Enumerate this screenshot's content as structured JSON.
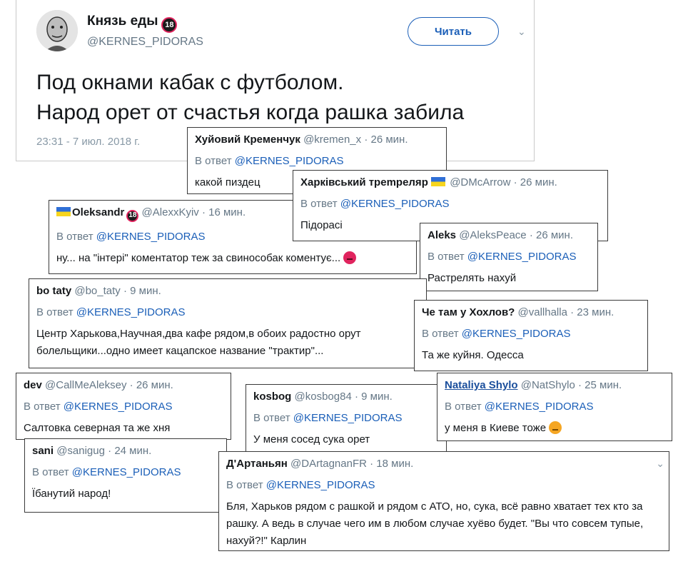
{
  "main": {
    "name": "Князь еды",
    "badge": "18",
    "handle": "@KERNES_PIDORAS",
    "follow_label": "Читать",
    "chevron": "chevron-down-icon",
    "text_line1": "Под окнами кабак с футболом.",
    "text_line2": "Народ орет от счастья когда рашка забила",
    "timestamp": "23:31 - 7 июл. 2018 г."
  },
  "reply_prefix": "В ответ",
  "reply_target": "@KERNES_PIDORAS",
  "dot": "·",
  "replies": [
    {
      "name": "Хуйовий Кременчук",
      "handle": "@kremen_x",
      "time": "26 мин.",
      "text": "какой пиздец"
    },
    {
      "name": "Харківський трempeляр",
      "handle": "@DMcArrow",
      "time": "26 мин.",
      "text": "Підорасі",
      "flag": true
    },
    {
      "name": "Oleksandr",
      "handle": "@AlexxKyiv",
      "time": "16 мин.",
      "text": "ну... на \"інтері\" коментатор теж за свинособак коментує...",
      "flag": true,
      "badge": "18",
      "emoji": "angry-face-icon"
    },
    {
      "name": "Aleks",
      "handle": "@AleksPeace",
      "time": "26 мин.",
      "text": "Растрелять нахуй"
    },
    {
      "name": "bo taty",
      "handle": "@bo_taty",
      "time": "9 мин.",
      "text": "Центр Харькова,Научная,два кафе рядом,в обоих радостно орут болельщики...одно имеет кацапское название \"трактир\"..."
    },
    {
      "name": "Че там у Хохлов?",
      "handle": "@vallhalla",
      "time": "23 мин.",
      "text": "Та же куйня. Одесса"
    },
    {
      "name": "dev",
      "handle": "@CallMeAleksey",
      "time": "26 мин.",
      "text": "Салтовка северная та же хня"
    },
    {
      "name": "kosbog",
      "handle": "@kosbog84",
      "time": "9 мин.",
      "text": "У меня сосед  сука орет"
    },
    {
      "name": "Nataliya Shylo",
      "handle": "@NatShylo",
      "time": "25 мин.",
      "text": "у меня в Киеве тоже",
      "emoji": "pouting-face-icon"
    },
    {
      "name": "sani",
      "handle": "@sanigug",
      "time": "24 мин.",
      "text": "Їбанутий народ!"
    },
    {
      "name": "Д'Артаньян",
      "handle": "@DArtagnanFR",
      "time": "18 мин.",
      "text": "Бля, Харьков рядом с рашкой и рядом с АТО, но, сука, всё равно хватает тех кто за рашку. А ведь в случае чего им в любом случае хуёво будет. \"Вы что совсем тупые, нахуй?!\" Карлин"
    }
  ]
}
